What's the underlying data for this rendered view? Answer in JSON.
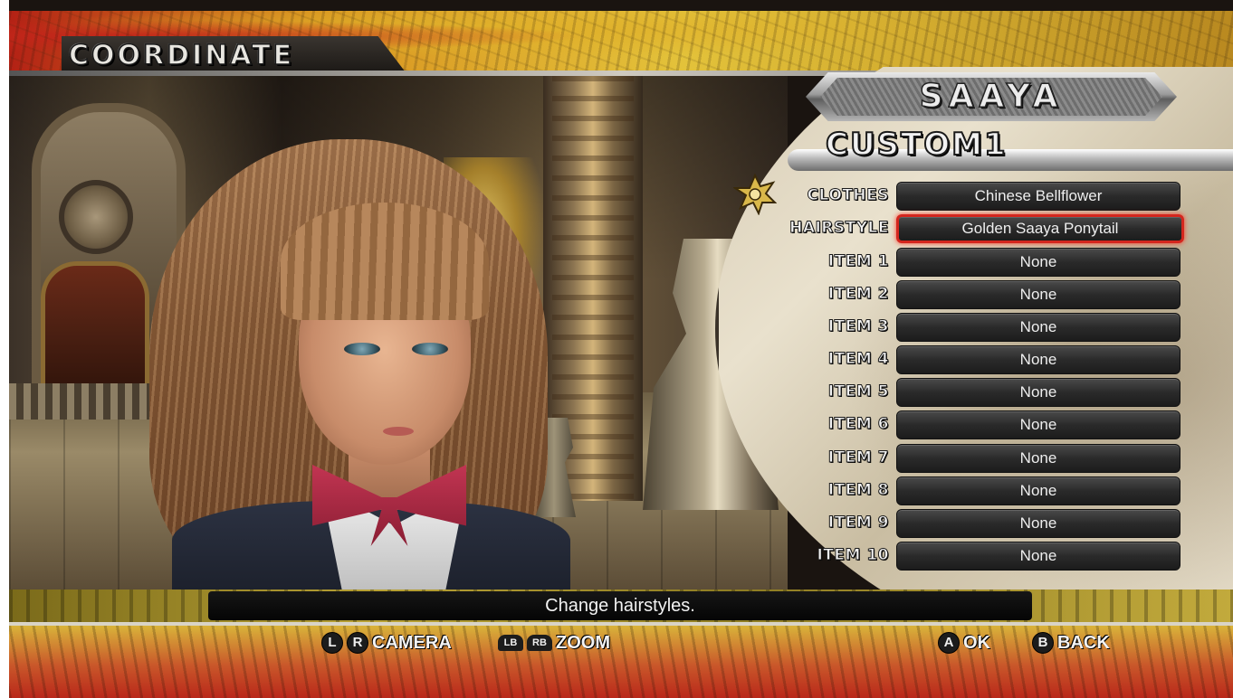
{
  "screen_title": "COORDINATE",
  "character_name": "SAAYA",
  "preset_name": "CUSTOM1",
  "slots": [
    {
      "label": "CLOTHES",
      "value": "Chinese Bellflower",
      "selected": false
    },
    {
      "label": "HAIRSTYLE",
      "value": "Golden Saaya Ponytail",
      "selected": true
    },
    {
      "label": "ITEM 1",
      "value": "None",
      "selected": false
    },
    {
      "label": "ITEM 2",
      "value": "None",
      "selected": false
    },
    {
      "label": "ITEM 3",
      "value": "None",
      "selected": false
    },
    {
      "label": "ITEM 4",
      "value": "None",
      "selected": false
    },
    {
      "label": "ITEM 5",
      "value": "None",
      "selected": false
    },
    {
      "label": "ITEM 6",
      "value": "None",
      "selected": false
    },
    {
      "label": "ITEM 7",
      "value": "None",
      "selected": false
    },
    {
      "label": "ITEM 8",
      "value": "None",
      "selected": false
    },
    {
      "label": "ITEM 9",
      "value": "None",
      "selected": false
    },
    {
      "label": "ITEM 10",
      "value": "None",
      "selected": false
    }
  ],
  "help_text": "Change hairstyles.",
  "controls": {
    "camera": {
      "buttons": [
        "L",
        "R"
      ],
      "label": "CAMERA"
    },
    "zoom": {
      "buttons": [
        "LB",
        "RB"
      ],
      "label": "ZOOM"
    },
    "ok": {
      "button": "A",
      "label": "OK"
    },
    "back": {
      "button": "B",
      "label": "BACK"
    }
  },
  "colors": {
    "selection_border": "#d4261e",
    "slot_background": "#2a2a2a",
    "banner_red": "#b32115",
    "banner_yellow": "#e3c23a"
  }
}
